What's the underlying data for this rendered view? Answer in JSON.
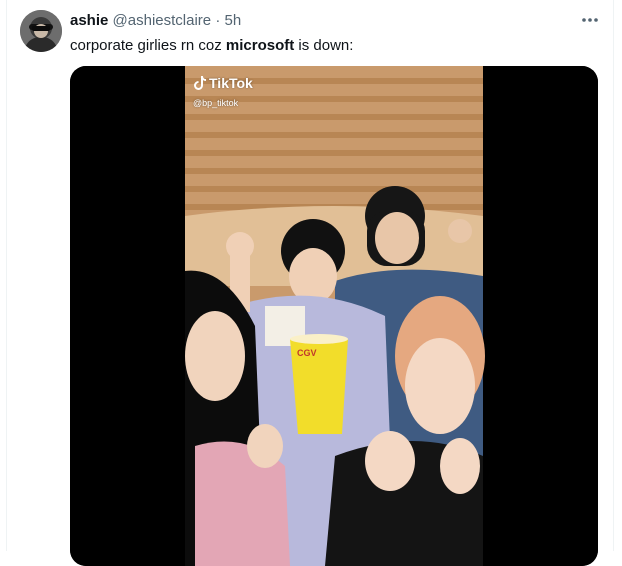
{
  "tweet": {
    "display_name": "ashie",
    "handle": "@ashiestclaire",
    "separator": "·",
    "time": "5h",
    "text_before": "corporate girlies rn coz ",
    "text_bold": "microsoft",
    "text_after": " is down:",
    "more_icon": "more-horizontal-icon"
  },
  "video": {
    "watermark_brand": "TikTok",
    "watermark_handle": "@bp_tiktok",
    "cup_text": "CGV"
  },
  "colors": {
    "text_primary": "#0f1419",
    "text_muted": "#536471",
    "border": "#eff3f4",
    "cup_yellow": "#f2dd2a",
    "wood": "#d4a87a"
  }
}
